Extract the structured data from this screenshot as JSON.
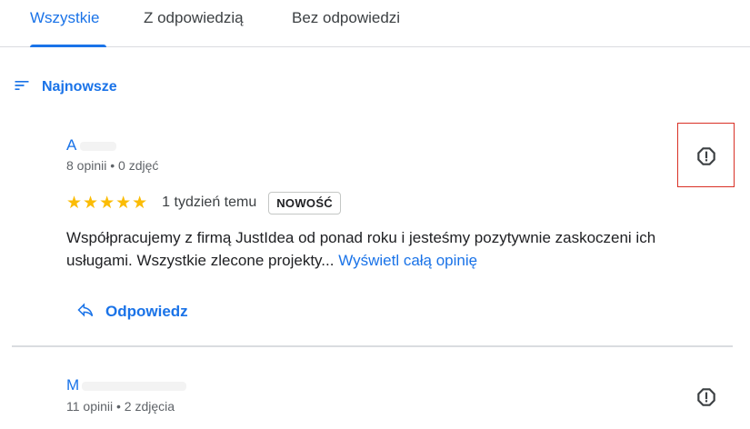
{
  "tabs": [
    {
      "label": "Wszystkie",
      "active": true
    },
    {
      "label": "Z odpowiedzią",
      "active": false
    },
    {
      "label": "Bez odpowiedzi",
      "active": false
    }
  ],
  "sort": {
    "label": "Najnowsze",
    "icon": "sort-icon"
  },
  "reviews": [
    {
      "name": "A",
      "meta": "8 opinii • 0 zdjęć",
      "rating": 5,
      "stars": "★★★★★",
      "time": "1 tydzień temu",
      "badge": "NOWOŚĆ",
      "text": "Współpracujemy z firmą JustIdea od ponad roku i jesteśmy pozytywnie zaskoczeni ich usługami. Wszystkie zlecone projekty... ",
      "more_label": "Wyświetl całą opinię",
      "reply_label": "Odpowiedz"
    },
    {
      "name": "M",
      "meta": "11 opinii • 2 zdjęcia"
    }
  ],
  "colors": {
    "accent": "#1a73e8",
    "stars": "#fbbc04",
    "divider": "#dadce0",
    "highlight": "#d93025"
  },
  "icons": {
    "flag": "report-icon",
    "reply": "reply-icon"
  }
}
